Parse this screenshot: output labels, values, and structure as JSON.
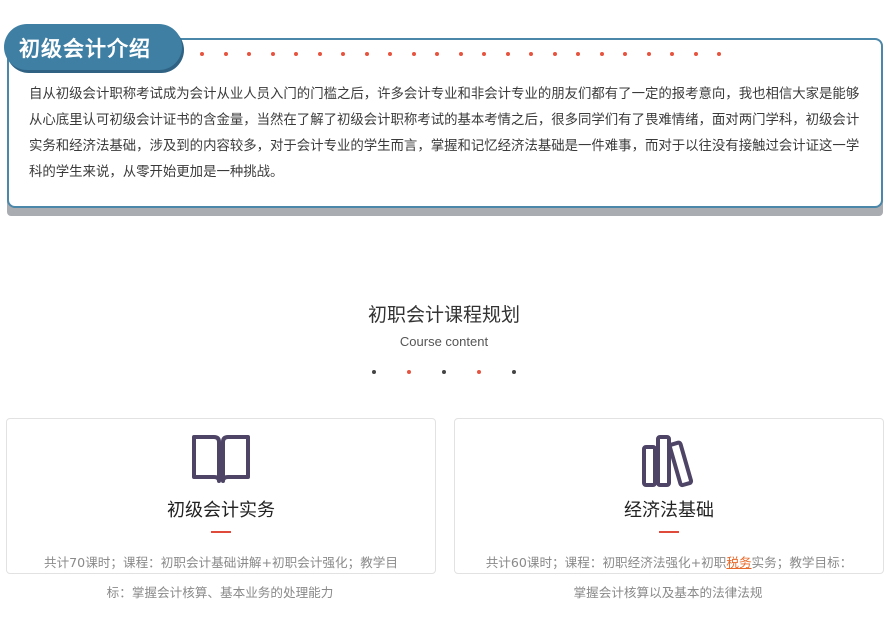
{
  "intro": {
    "title": "初级会计介绍",
    "paragraph": "自从初级会计职称考试成为会计从业人员入门的门槛之后，许多会计专业和非会计专业的朋友们都有了一定的报考意向，我也相信大家是能够从心底里认可初级会计证书的含金量，当然在了解了初级会计职称考试的基本考情之后，很多同学们有了畏难情绪，面对两门学科，初级会计实务和经济法基础，涉及到的内容较多，对于会计专业的学生而言，掌握和记忆经济法基础是一件难事，而对于以往没有接触过会计证这一学科的学生来说，从零开始更加是一种挑战。"
  },
  "section": {
    "title": "初职会计课程规划",
    "subtitle": "Course content"
  },
  "courses": [
    {
      "icon": "book-icon",
      "title": "初级会计实务",
      "desc_line1": "共计70课时；课程：初职会计基础讲解+初职会计强化；教学目",
      "desc_line2": "标：掌握会计核算、基本业务的处理能力"
    },
    {
      "icon": "books-icon",
      "title": "经济法基础",
      "desc_line1_a": "共计60课时；课程：初职经济法强化+初职",
      "desc_line1_hl": "税务",
      "desc_line1_b": "实务；教学目标：",
      "desc_line2": "掌握会计核算以及基本的法律法规"
    }
  ],
  "colors": {
    "accent_blue": "#3f7fa4",
    "accent_red": "#e04a3b",
    "icon_purple": "#4e4466",
    "highlight_orange": "#e86a2b"
  }
}
